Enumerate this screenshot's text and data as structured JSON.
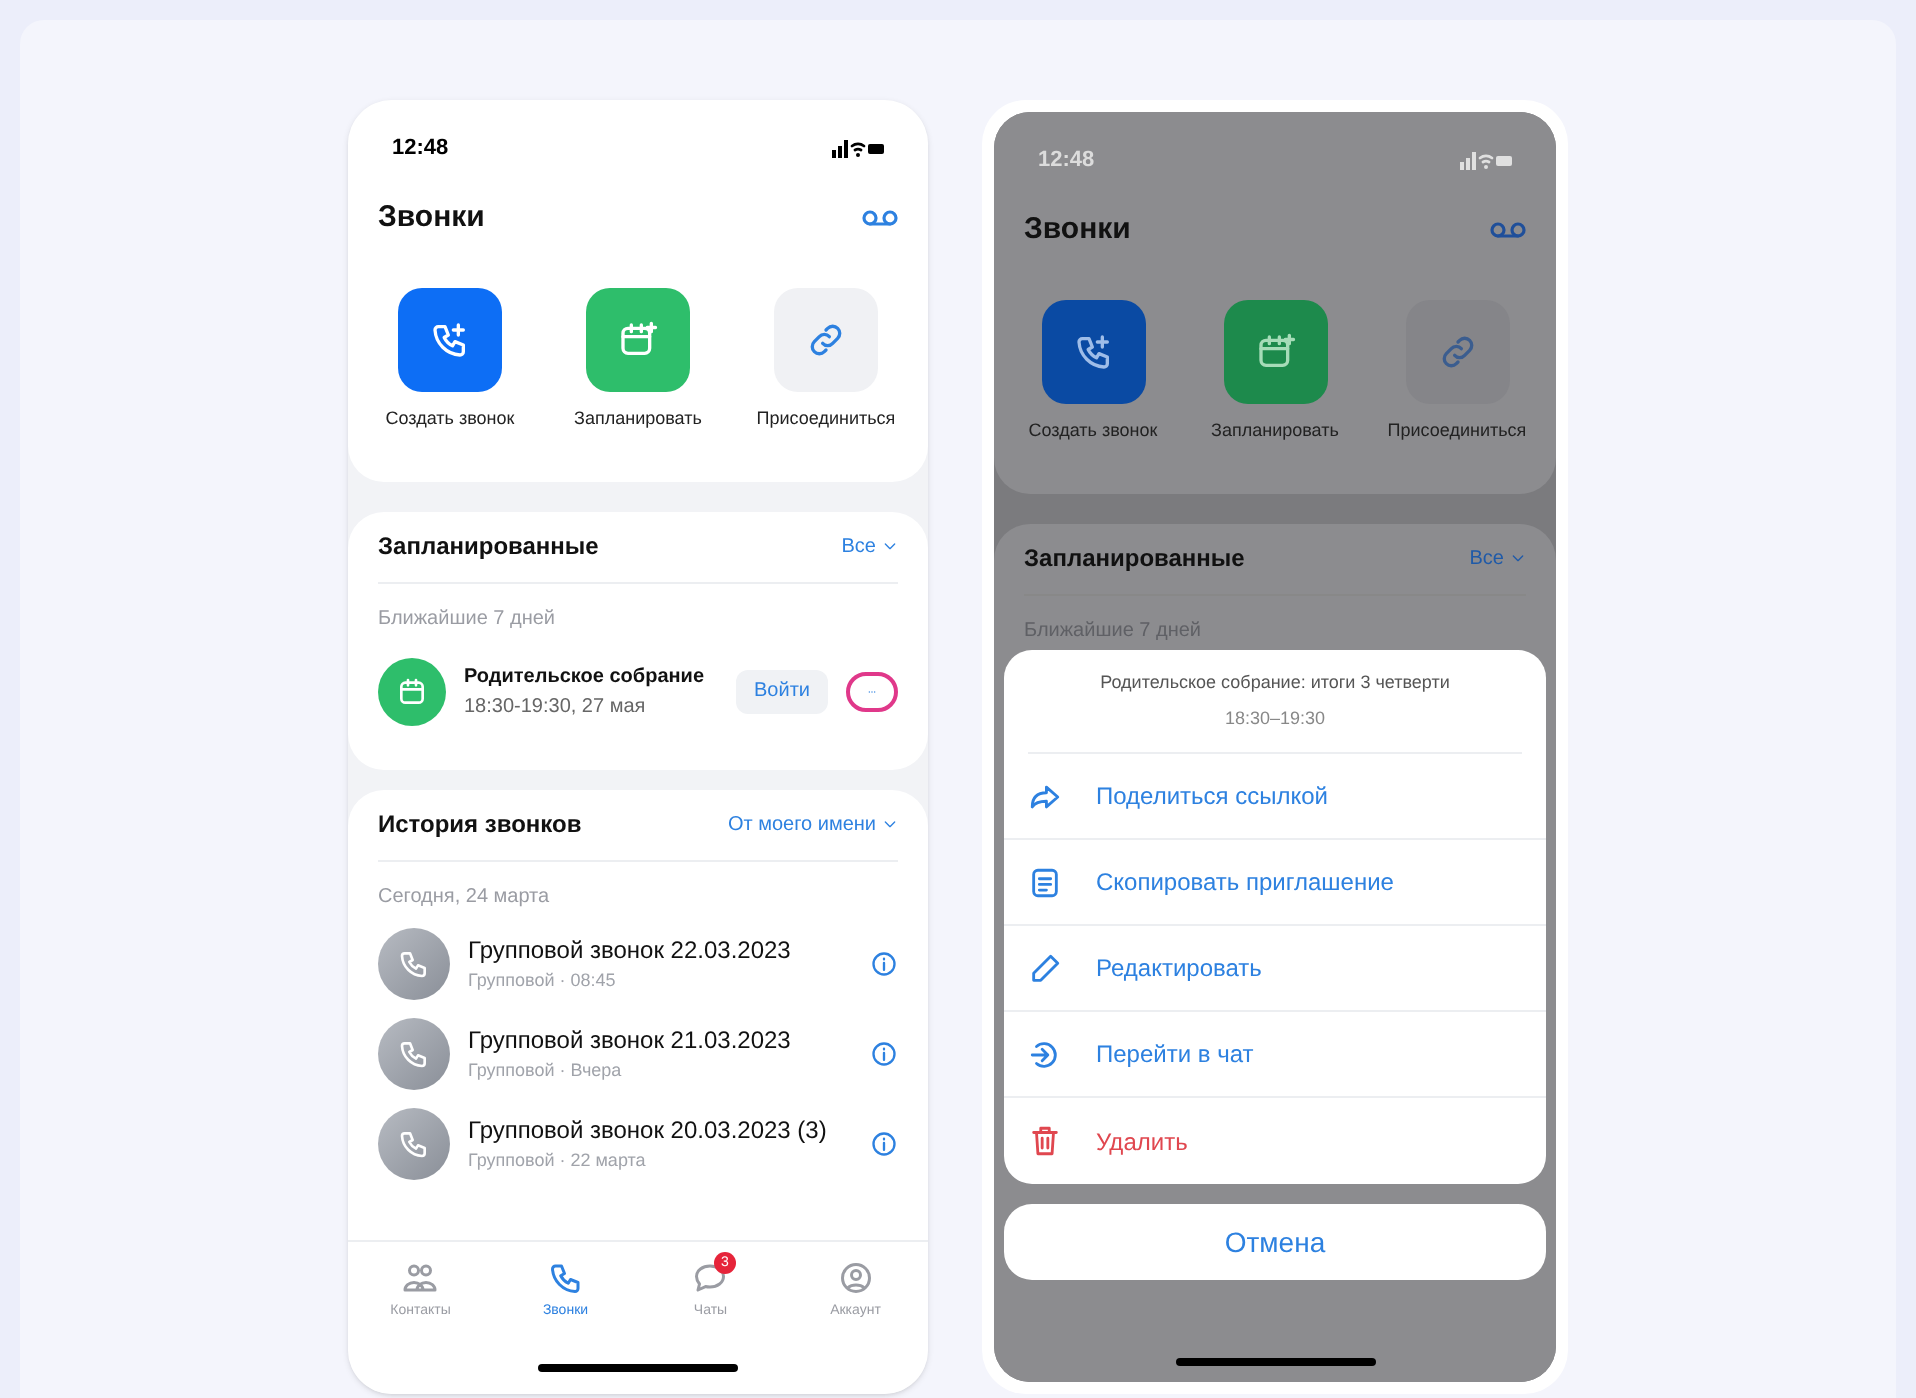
{
  "left_screen": {
    "status_time": "12:48",
    "title": "Звонки",
    "actions": [
      {
        "kind": "create",
        "label": "Создать звонок"
      },
      {
        "kind": "schedule",
        "label": "Запланировать"
      },
      {
        "kind": "join",
        "label": "Присоединиться"
      }
    ],
    "scheduled": {
      "title": "Запланированные",
      "filter": "Все",
      "subtitle": "Ближайшие 7 дней",
      "meeting": {
        "title": "Родительское собрание",
        "time": "18:30-19:30, 27 мая",
        "join_label": "Войти",
        "more_highlighted": true
      }
    },
    "history": {
      "title": "История звонков",
      "filter": "От моего имени",
      "date": "Сегодня, 24 марта",
      "calls": [
        {
          "title": "Групповой звонок 22.03.2023",
          "meta": "Групповой · 08:45"
        },
        {
          "title": "Групповой звонок 21.03.2023",
          "meta": "Групповой · Вчера"
        },
        {
          "title": "Групповой звонок 20.03.2023 (3)",
          "meta": "Групповой · 22 марта"
        }
      ]
    },
    "tabs": [
      {
        "kind": "contacts",
        "label": "Контакты",
        "selected": false
      },
      {
        "kind": "calls",
        "label": "Звонки",
        "selected": true
      },
      {
        "kind": "chats",
        "label": "Чаты",
        "selected": false,
        "badge": "3"
      },
      {
        "kind": "account",
        "label": "Аккаунт",
        "selected": false
      }
    ]
  },
  "right_screen": {
    "status_time": "12:48",
    "title": "Звонки",
    "actions": [
      {
        "kind": "create",
        "label": "Создать звонок"
      },
      {
        "kind": "schedule",
        "label": "Запланировать"
      },
      {
        "kind": "join",
        "label": "Присоединиться"
      }
    ],
    "scheduled": {
      "title": "Запланированные",
      "filter": "Все",
      "subtitle": "Ближайшие 7 дней"
    },
    "sheet": {
      "title": "Родительское собрание: итоги 3 четверти",
      "time": "18:30–19:30",
      "items": [
        {
          "kind": "share",
          "label": "Поделиться ссылкой",
          "destructive": false
        },
        {
          "kind": "copy",
          "label": "Скопировать приглашение",
          "destructive": false
        },
        {
          "kind": "edit",
          "label": "Редактировать",
          "destructive": false
        },
        {
          "kind": "chat",
          "label": "Перейти в чат",
          "destructive": false
        },
        {
          "kind": "delete",
          "label": "Удалить",
          "destructive": true
        }
      ],
      "cancel": "Отмена"
    }
  }
}
